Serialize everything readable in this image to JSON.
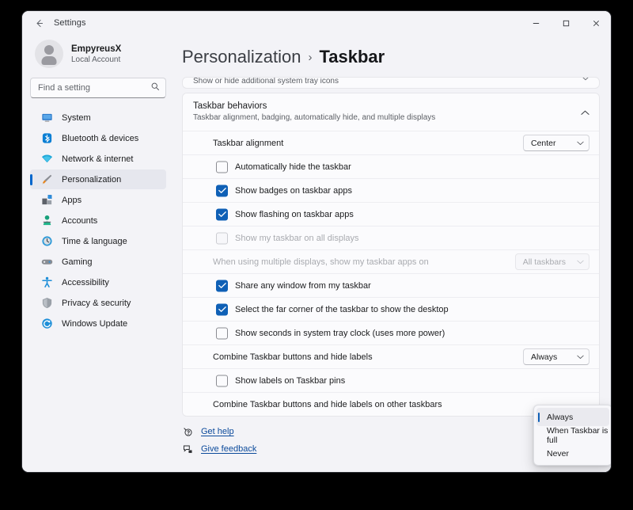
{
  "window": {
    "titlebar": {
      "back_icon": "back-arrow-icon",
      "title": "Settings",
      "minimize_label": "–",
      "maximize_label": "□",
      "close_label": "✕"
    }
  },
  "sidebar": {
    "account": {
      "name": "EmpyreusX",
      "subtitle": "Local Account",
      "avatar_icon": "avatar-icon"
    },
    "search": {
      "placeholder": "Find a setting",
      "value": "",
      "icon": "search-icon"
    },
    "items": [
      {
        "label": "System",
        "icon": "monitor-icon",
        "active": false
      },
      {
        "label": "Bluetooth & devices",
        "icon": "bluetooth-icon",
        "active": false
      },
      {
        "label": "Network & internet",
        "icon": "wifi-icon",
        "active": false
      },
      {
        "label": "Personalization",
        "icon": "paintbrush-icon",
        "active": true
      },
      {
        "label": "Apps",
        "icon": "apps-icon",
        "active": false
      },
      {
        "label": "Accounts",
        "icon": "person-icon",
        "active": false
      },
      {
        "label": "Time & language",
        "icon": "clock-icon",
        "active": false
      },
      {
        "label": "Gaming",
        "icon": "gamepad-icon",
        "active": false
      },
      {
        "label": "Accessibility",
        "icon": "accessibility-icon",
        "active": false
      },
      {
        "label": "Privacy & security",
        "icon": "shield-icon",
        "active": false
      },
      {
        "label": "Windows Update",
        "icon": "update-icon",
        "active": false
      }
    ]
  },
  "main": {
    "breadcrumb": {
      "root": "Personalization",
      "separator": "›",
      "leaf": "Taskbar"
    },
    "tray_card": {
      "label": "Show or hide additional system tray icons",
      "chevron": "chevron-down-icon"
    },
    "expander": {
      "title": "Taskbar behaviors",
      "subtitle": "Taskbar alignment, badging, automatically hide, and multiple displays",
      "chevron": "chevron-up-icon"
    },
    "rows": [
      {
        "kind": "combo",
        "label": "Taskbar alignment",
        "value": "Center",
        "disabled": false
      },
      {
        "kind": "checkbox",
        "label": "Automatically hide the taskbar",
        "checked": false,
        "disabled": false
      },
      {
        "kind": "checkbox",
        "label": "Show badges on taskbar apps",
        "checked": true,
        "disabled": false
      },
      {
        "kind": "checkbox",
        "label": "Show flashing on taskbar apps",
        "checked": true,
        "disabled": false
      },
      {
        "kind": "checkbox",
        "label": "Show my taskbar on all displays",
        "checked": false,
        "disabled": true
      },
      {
        "kind": "combo",
        "label": "When using multiple displays, show my taskbar apps on",
        "value": "All taskbars",
        "disabled": true
      },
      {
        "kind": "checkbox",
        "label": "Share any window from my taskbar",
        "checked": true,
        "disabled": false
      },
      {
        "kind": "checkbox",
        "label": "Select the far corner of the taskbar to show the desktop",
        "checked": true,
        "disabled": false
      },
      {
        "kind": "checkbox",
        "label": "Show seconds in system tray clock (uses more power)",
        "checked": false,
        "disabled": false
      },
      {
        "kind": "combo",
        "label": "Combine Taskbar buttons and hide labels",
        "value": "Always",
        "disabled": false
      },
      {
        "kind": "checkbox",
        "label": "Show labels on Taskbar pins",
        "checked": false,
        "disabled": false
      },
      {
        "kind": "combo-open",
        "label": "Combine Taskbar buttons and hide labels on other taskbars",
        "value": "Always",
        "disabled": false
      }
    ],
    "footer": [
      {
        "label": "Get help",
        "icon": "help-icon"
      },
      {
        "label": "Give feedback",
        "icon": "feedback-icon"
      }
    ],
    "open_dropdown": {
      "options": [
        {
          "label": "Always",
          "selected": true
        },
        {
          "label": "When Taskbar is full",
          "selected": false
        },
        {
          "label": "Never",
          "selected": false
        }
      ]
    }
  },
  "colors": {
    "accent": "#0f60b6",
    "selection_bar": "#0066cc",
    "link": "#0b4a9b",
    "window_bg": "#f3f3f7",
    "card_bg": "#fbfbfd",
    "desktop_bg": "#000000"
  }
}
